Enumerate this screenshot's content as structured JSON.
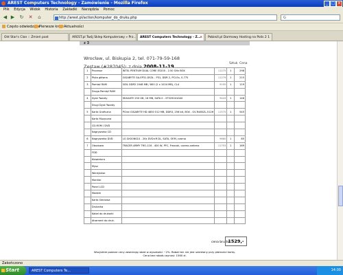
{
  "window": {
    "title": "AREST Computers Technology - Zamówienie - Mozilla Firefox"
  },
  "menu": [
    "Plik",
    "Edycja",
    "Widok",
    "Historia",
    "Zakładki",
    "Narzędzia",
    "Pomoc"
  ],
  "nav": {
    "url": "http://arest.pl/action/komputer_do_druku.php"
  },
  "bookmarks": [
    "Często odwiedzane",
    "Pierwsze kroki",
    "Aktualności"
  ],
  "tabs": [
    {
      "label": "Old Star's Clan :: Zmień post"
    },
    {
      "label": "AREST.pl Twój Sklep Komputerowy » Prz..."
    },
    {
      "label": "AREST Computers Technology - Z..."
    },
    {
      "label": "Pobieżl.pl Darmowy Hosting na Polis 2 1"
    }
  ],
  "page": {
    "top_label": "z 3",
    "address": "Wrocław, ul. Biskupia 2, tel. 071-79-59-168",
    "set_label": "Zestaw (#287045): z dnia",
    "set_date": "2008-11-19",
    "col_qty": "Sztuk",
    "col_price": "Cena",
    "rows": [
      {
        "num": "1",
        "cat": "Procesor",
        "desc": "INTEL PENTIUM DUAL CORE E5200 - 2.50 GHz BOX",
        "code": "11275",
        "qty": "1",
        "price": "298"
      },
      {
        "num": "2",
        "cat": "Płyta główna",
        "desc": "GIGABYTE GA-EP31-DS3L - P31, DDR 2, PCI-Ex, S-775",
        "code": "11279",
        "qty": "1",
        "price": "215"
      },
      {
        "num": "3",
        "cat": "Pamięć RAM",
        "desc": "GEIL DDR2 2048 MB / 800 (2 x 1024 MB), CL4",
        "code": "9195",
        "qty": "1",
        "price": "119"
      },
      {
        "num": "",
        "cat": "Druga Pamięć RAM",
        "desc": "",
        "code": "",
        "qty": "",
        "price": ""
      },
      {
        "num": "4",
        "cat": "Dysk Twardy",
        "desc": "SEAGATE 250 GB, 16 MB, SATA II - ST3250410AS",
        "code": "9443",
        "qty": "1",
        "price": "148"
      },
      {
        "num": "",
        "cat": "Drugi Dysk Twardy",
        "desc": "",
        "code": "",
        "qty": "",
        "price": ""
      },
      {
        "num": "5",
        "cat": "Karta Graficzna",
        "desc": "PCIex GIGABYTE HD 4850 512 MB, DDR3, 256 bit, BOX - GV-R485ZL-512H",
        "code": "11575",
        "qty": "1",
        "price": "545"
      },
      {
        "num": "",
        "cat": "Karta Muzyczna",
        "desc": "",
        "code": "",
        "qty": "",
        "price": ""
      },
      {
        "num": "",
        "cat": "CD-ROM / DVD",
        "desc": "",
        "code": "",
        "qty": "",
        "price": ""
      },
      {
        "num": "",
        "cat": "Nagrywarka CD",
        "desc": "",
        "code": "",
        "qty": "",
        "price": ""
      },
      {
        "num": "6",
        "cat": "Nagrywarka DVD",
        "desc": "LG GH20NS10 - 20x DVD±R DL, SATA, OEM, czarna",
        "code": "9660",
        "qty": "1",
        "price": "85"
      },
      {
        "num": "7",
        "cat": "Obudowa",
        "desc": "TRACER ARMY TRO-116 - 400 W, PFC, Frezcok, czarno-srebrna",
        "code": "11793",
        "qty": "1",
        "price": "169"
      },
      {
        "num": "",
        "cat": "FDD",
        "desc": "",
        "code": "",
        "qty": "",
        "price": ""
      },
      {
        "num": "",
        "cat": "Klawiatura",
        "desc": "",
        "code": "",
        "qty": "",
        "price": ""
      },
      {
        "num": "",
        "cat": "Mysz",
        "desc": "",
        "code": "",
        "qty": "",
        "price": ""
      },
      {
        "num": "",
        "cat": "Wentylator",
        "desc": "",
        "code": "",
        "qty": "",
        "price": ""
      },
      {
        "num": "",
        "cat": "Monitor",
        "desc": "",
        "code": "",
        "qty": "",
        "price": ""
      },
      {
        "num": "",
        "cat": "Panel LCD",
        "desc": "",
        "code": "",
        "qty": "",
        "price": ""
      },
      {
        "num": "",
        "cat": "Modem",
        "desc": "",
        "code": "",
        "qty": "",
        "price": ""
      },
      {
        "num": "",
        "cat": "Karta Sieciowa",
        "desc": "",
        "code": "",
        "qty": "",
        "price": ""
      },
      {
        "num": "",
        "cat": "Drukarka",
        "desc": "",
        "code": "",
        "qty": "",
        "price": ""
      },
      {
        "num": "",
        "cat": "Kabel do drukarki",
        "desc": "",
        "code": "",
        "qty": "",
        "price": ""
      },
      {
        "num": "",
        "cat": "Atrament do druk.",
        "desc": "",
        "code": "",
        "qty": "",
        "price": ""
      }
    ],
    "sum_label": "cena brutto:",
    "sum_value": "1529,-",
    "footer_line1": "Wszystkie podane ceny zawierają rabat w wysokości ~2%. Rabat ten nie jest udzielany przy płatności kartą.",
    "footer_line2": "Cena bez rabatu wynosi: 1560 zł."
  },
  "status": {
    "text": "Zakończono"
  },
  "taskbar": {
    "start": "Start",
    "task": "AREST Computers Te...",
    "clock": "14:00"
  }
}
